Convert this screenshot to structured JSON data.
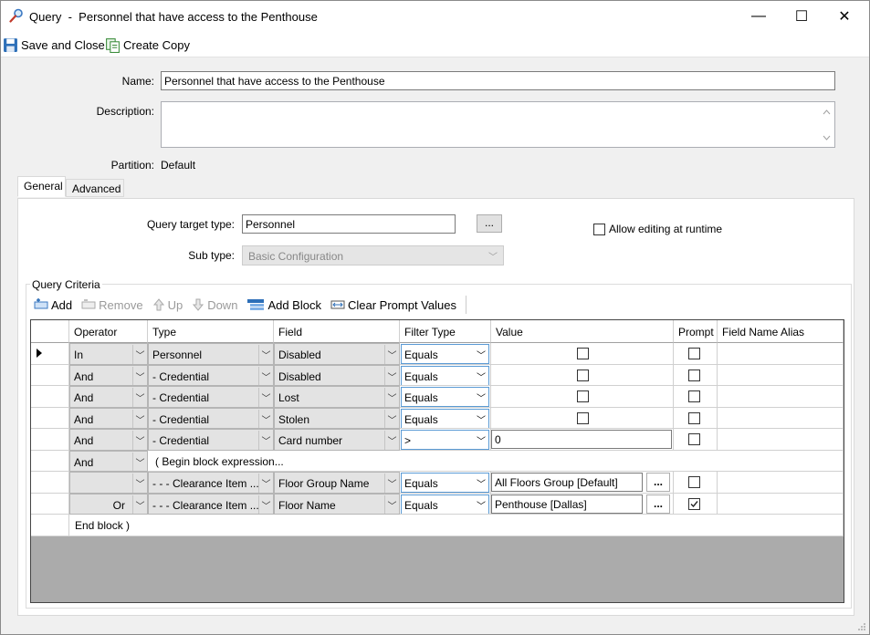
{
  "window": {
    "title": "Query  -  Personnel that have access to the Penthouse",
    "minimize": "—",
    "maximize": "☐",
    "close": "✕"
  },
  "toolbar": {
    "save_label": "Save and Close",
    "copy_label": "Create Copy"
  },
  "form": {
    "name_label": "Name:",
    "name_value": "Personnel that have access to the Penthouse",
    "description_label": "Description:",
    "description_value": "",
    "partition_label": "Partition:",
    "partition_value": "Default"
  },
  "tabs": [
    {
      "label": "General",
      "active": true
    },
    {
      "label": "Advanced",
      "active": false
    }
  ],
  "general": {
    "target_type_label": "Query target type:",
    "target_type_value": "Personnel",
    "browse_label": "...",
    "allow_editing_label": "Allow editing at runtime",
    "allow_editing_checked": false,
    "sub_type_label": "Sub type:",
    "sub_type_value": "Basic Configuration"
  },
  "criteria": {
    "group_title": "Query Criteria",
    "toolbar": [
      {
        "label": "Add",
        "icon": "add-icon",
        "enabled": true
      },
      {
        "label": "Remove",
        "icon": "remove-icon",
        "enabled": false
      },
      {
        "label": "Up",
        "icon": "up-icon",
        "enabled": false
      },
      {
        "label": "Down",
        "icon": "down-icon",
        "enabled": false
      },
      {
        "label": "Add Block",
        "icon": "add-block-icon",
        "enabled": true
      },
      {
        "label": "Clear Prompt Values",
        "icon": "clear-prompt-icon",
        "enabled": true
      }
    ],
    "columns": [
      "Operator",
      "Type",
      "Field",
      "Filter Type",
      "Value",
      "Prompt",
      "Field Name Alias"
    ],
    "rows": [
      {
        "operator": "In",
        "type": "Personnel",
        "field": "Disabled",
        "filter": "Equals",
        "value_kind": "checkbox",
        "value_checked": false,
        "prompt": false,
        "current": true
      },
      {
        "operator": "And",
        "type": "- Credential",
        "field": "Disabled",
        "filter": "Equals",
        "value_kind": "checkbox",
        "value_checked": false,
        "prompt": false
      },
      {
        "operator": "And",
        "type": "- Credential",
        "field": "Lost",
        "filter": "Equals",
        "value_kind": "checkbox",
        "value_checked": false,
        "prompt": false
      },
      {
        "operator": "And",
        "type": "- Credential",
        "field": "Stolen",
        "filter": "Equals",
        "value_kind": "checkbox",
        "value_checked": false,
        "prompt": false
      },
      {
        "operator": "And",
        "type": "- Credential",
        "field": "Card number",
        "filter": ">",
        "value_kind": "text",
        "value": "0",
        "prompt": false
      },
      {
        "operator": "And",
        "kind": "block-begin",
        "text": "( Begin block expression..."
      },
      {
        "operator": "",
        "type": "- - - Clearance Item ...",
        "field": "Floor Group Name",
        "filter": "Equals",
        "value_kind": "browse",
        "value": "All Floors Group  [Default]",
        "prompt": false
      },
      {
        "operator": "Or",
        "type": "- - - Clearance Item ...",
        "field": "Floor Name",
        "filter": "Equals",
        "value_kind": "browse",
        "value": "Penthouse  [Dallas]",
        "prompt": true
      },
      {
        "kind": "block-end",
        "text": "End block )"
      }
    ]
  }
}
